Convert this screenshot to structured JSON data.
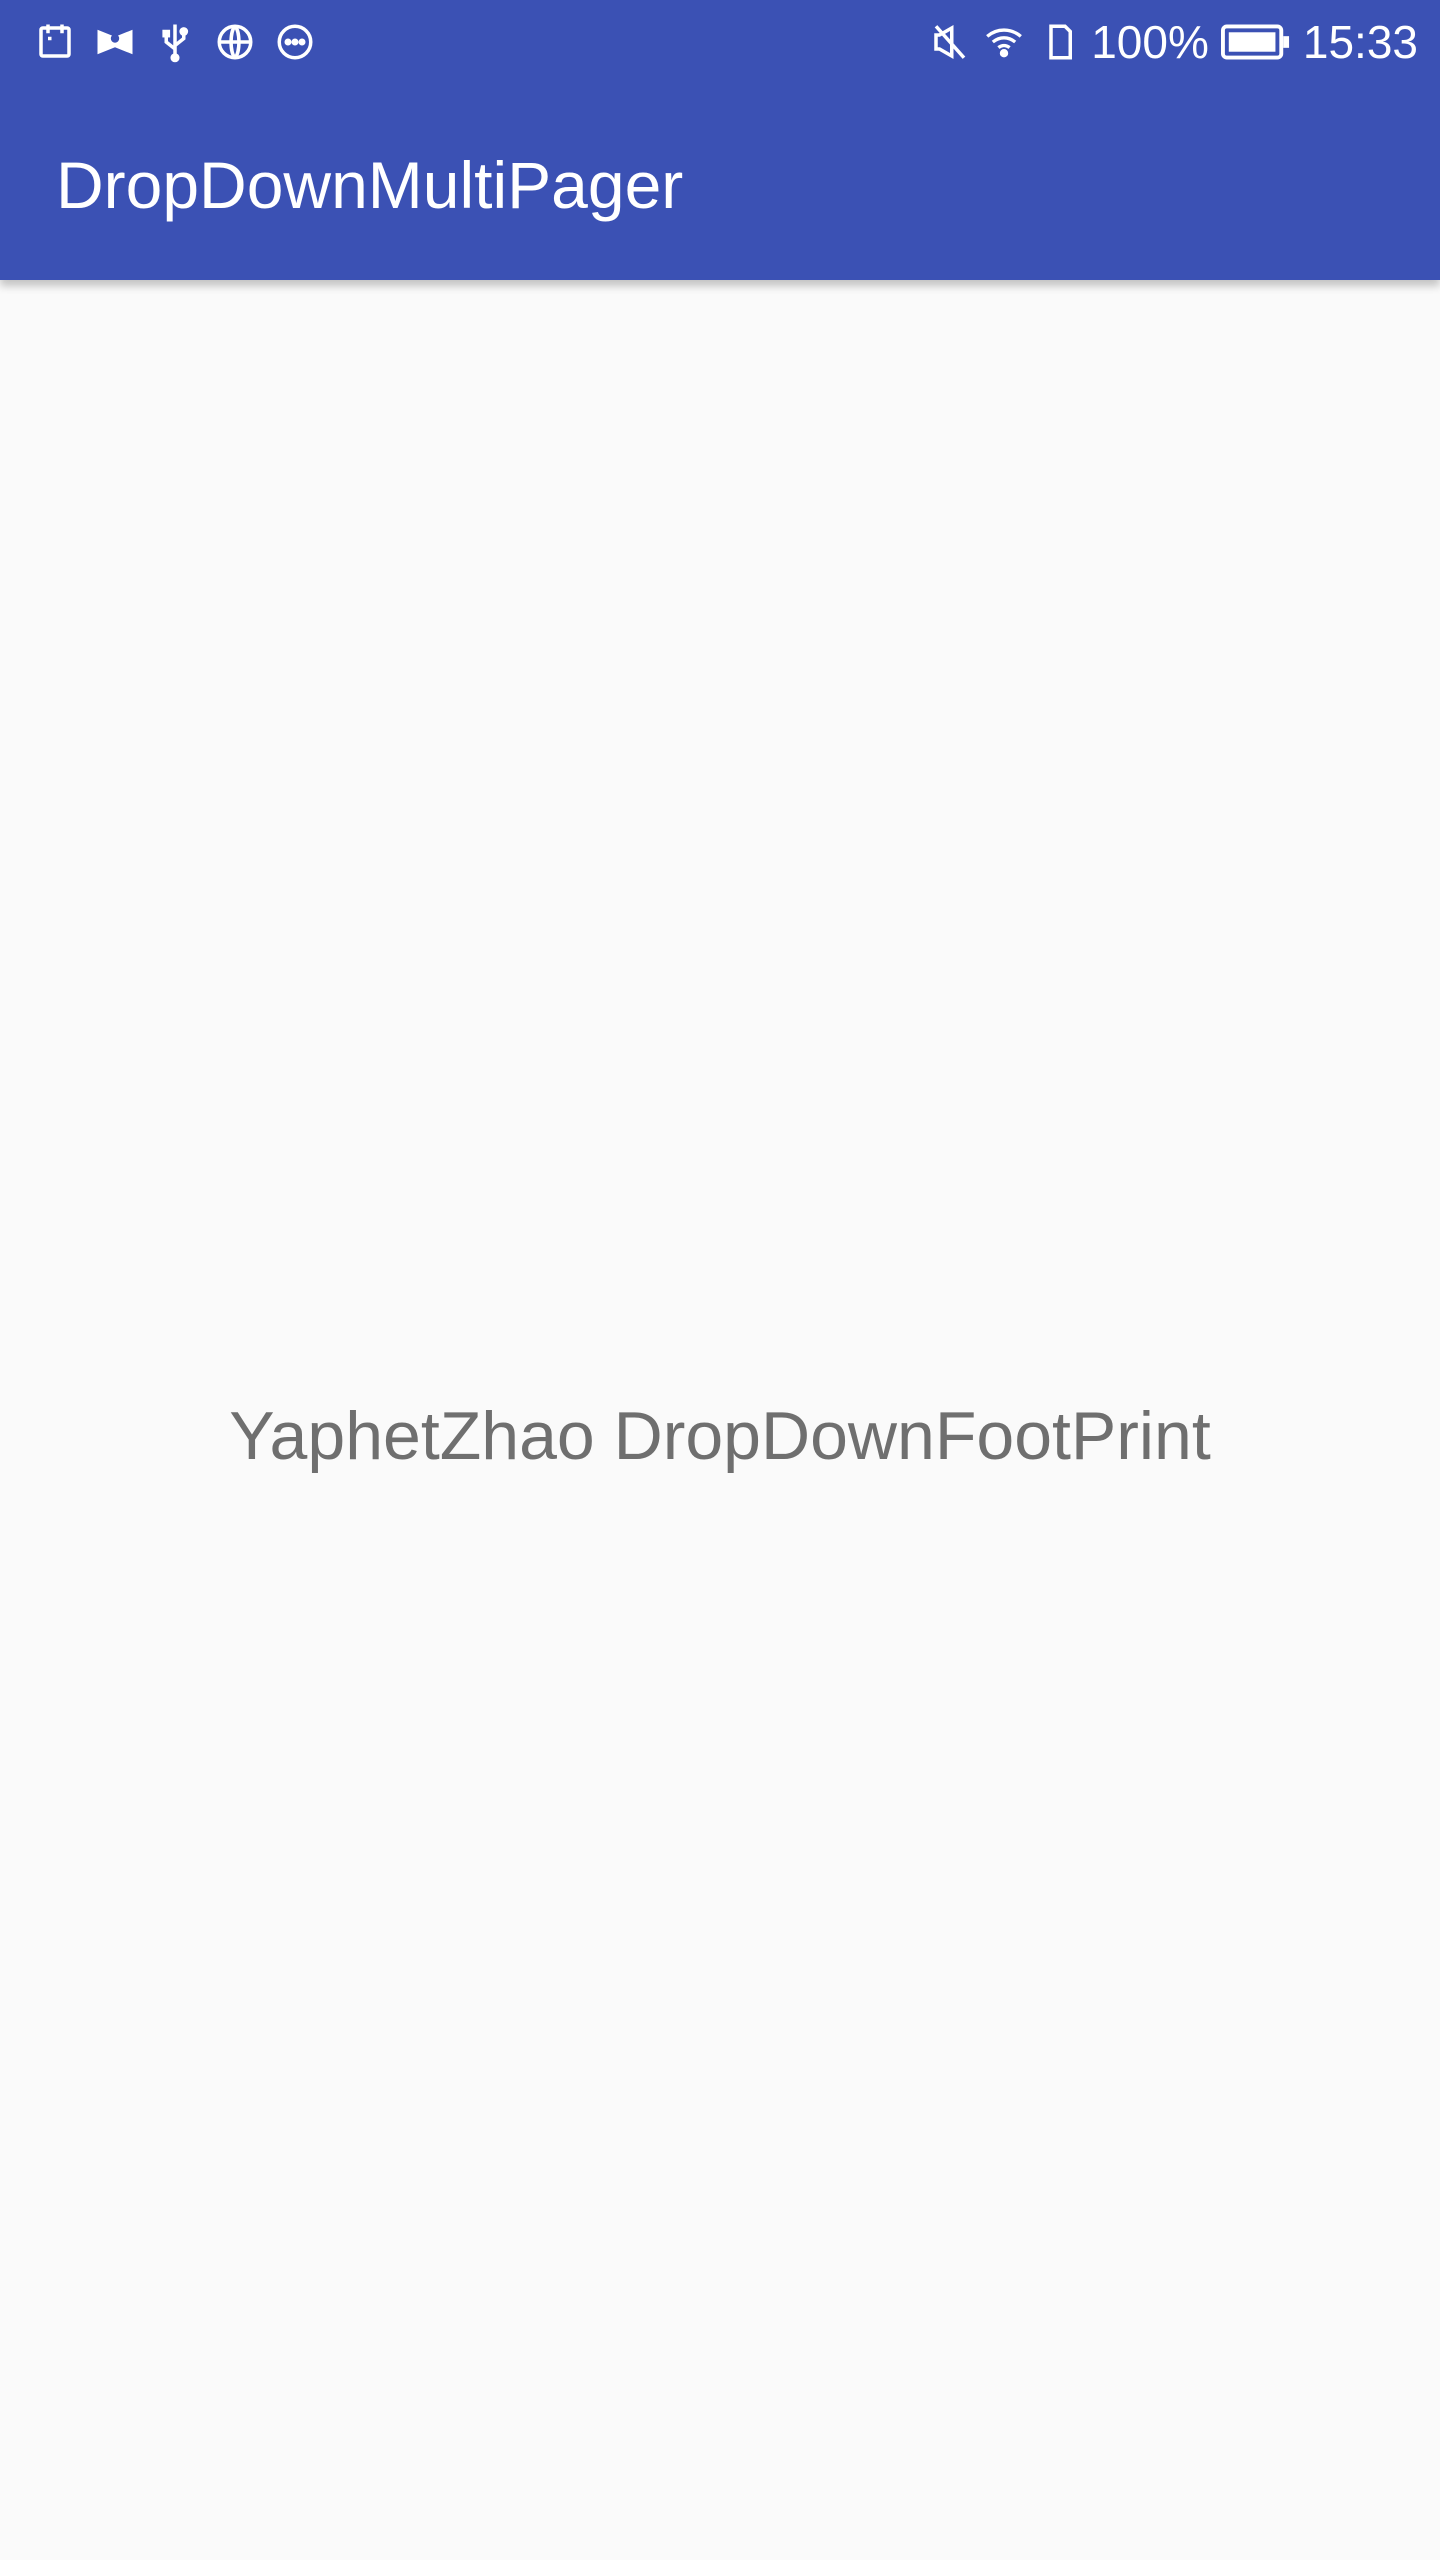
{
  "status_bar": {
    "left_icons": [
      "calendar-notification-icon",
      "photo-notification-icon",
      "usb-icon",
      "globe-icon",
      "more-notifications-icon"
    ],
    "right_icons": [
      "vibrate-off-icon",
      "wifi-icon",
      "sim-card-icon",
      "battery-icon"
    ],
    "battery_percent": "100%",
    "time": "15:33"
  },
  "app_bar": {
    "title": "DropDownMultiPager",
    "color": "#3b51b4"
  },
  "main": {
    "center_text": "YaphetZhao DropDownFootPrint",
    "background": "#fafafa"
  }
}
